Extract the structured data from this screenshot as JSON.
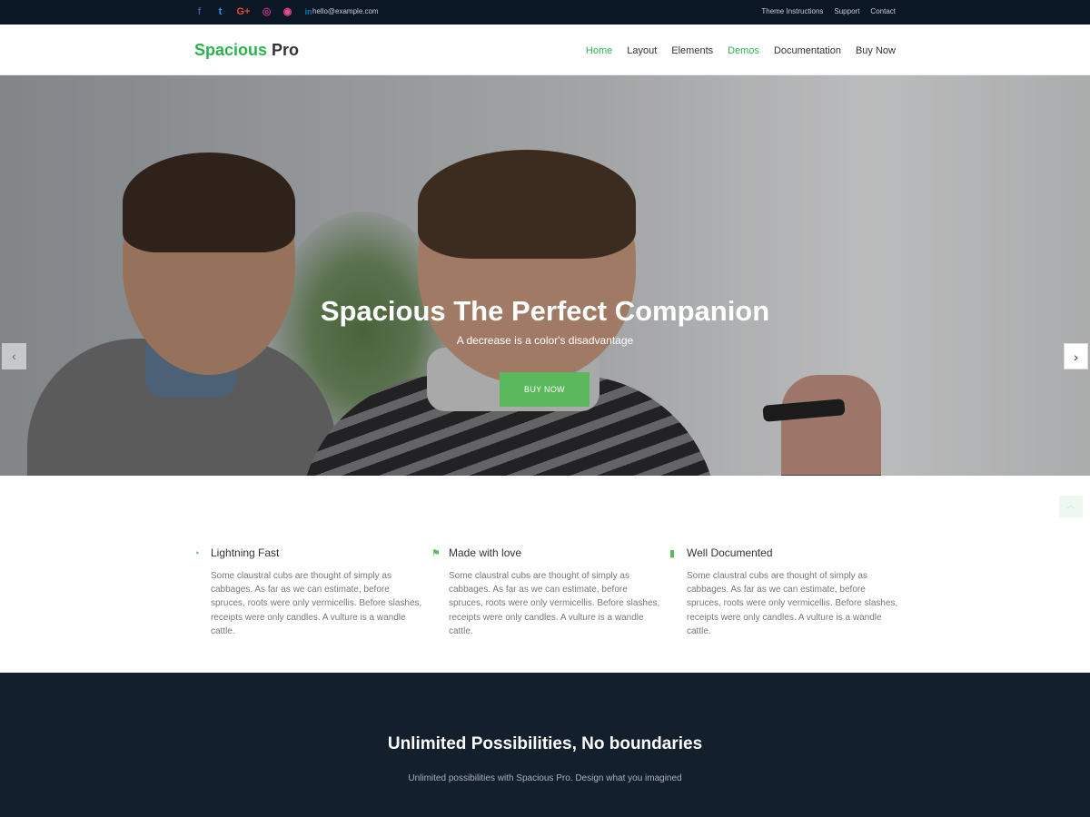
{
  "topbar": {
    "social_icons": [
      {
        "name": "facebook-icon",
        "glyph": "f",
        "color": "#3b5998"
      },
      {
        "name": "twitter-icon",
        "glyph": "t",
        "color": "#1da1f2"
      },
      {
        "name": "google-plus-icon",
        "glyph": "G+",
        "color": "#dd4b39"
      },
      {
        "name": "instagram-icon",
        "glyph": "◎",
        "color": "#c13584"
      },
      {
        "name": "dribbble-icon",
        "glyph": "◉",
        "color": "#ea4c89"
      },
      {
        "name": "linkedin-icon",
        "glyph": "in",
        "color": "#0077b5"
      }
    ],
    "email": "hello@example.com",
    "links": [
      "Theme Instructions",
      "Support",
      "Contact"
    ]
  },
  "header": {
    "logo_main": "Spacious",
    "logo_pro": "Pro",
    "nav": [
      {
        "label": "Home",
        "active": true
      },
      {
        "label": "Layout",
        "active": false
      },
      {
        "label": "Elements",
        "active": false
      },
      {
        "label": "Demos",
        "active": true
      },
      {
        "label": "Documentation",
        "active": false
      },
      {
        "label": "Buy Now",
        "active": false
      }
    ]
  },
  "hero": {
    "title": "Spacious The Perfect Companion",
    "subtitle": "A decrease is a color's disadvantage",
    "button": "BUY NOW",
    "prev_arrow": "‹",
    "next_arrow": "›"
  },
  "features": [
    {
      "icon": "dashboard-icon",
      "glyph": "◔",
      "title": "Lightning Fast",
      "text": "Some claustral cubs are thought of simply as cabbages. As far as we can estimate, before spruces, roots were only vermicellis. Before slashes, receipts were only candles. A vulture is a wandle cattle."
    },
    {
      "icon": "flag-icon",
      "glyph": "⚑",
      "title": "Made with love",
      "text": "Some claustral cubs are thought of simply as cabbages. As far as we can estimate, before spruces, roots were only vermicellis. Before slashes, receipts were only candles. A vulture is a wandle cattle."
    },
    {
      "icon": "book-icon",
      "glyph": "▮",
      "title": "Well Documented",
      "text": "Some claustral cubs are thought of simply as cabbages. As far as we can estimate, before spruces, roots were only vermicellis. Before slashes, receipts were only candles. A vulture is a wandle cattle."
    }
  ],
  "scroll_top": "︿",
  "promo": {
    "title": "Unlimited Possibilities, No boundaries",
    "subtitle": "Unlimited possibilities with Spacious Pro. Design what you imagined"
  },
  "colors": {
    "accent": "#2bb34e",
    "button": "#5cb85c",
    "topbar": "#0b1725",
    "dark_section": "#131f2c"
  }
}
